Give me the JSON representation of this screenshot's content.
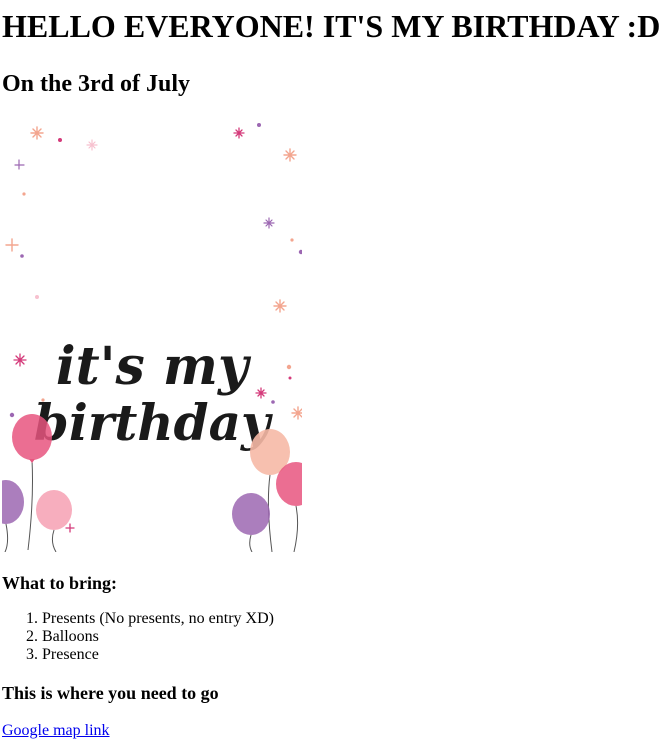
{
  "page": {
    "heading": "HELLO EVERYONE! IT'S MY BIRTHDAY :D",
    "subheading": "On the 3rd of July",
    "card": {
      "line1": "it's my",
      "line2": "birthday",
      "colors": {
        "pink": "#e8557f",
        "peach": "#f6b9a6",
        "purple": "#9c67b2",
        "ink": "#1a1a1a"
      }
    },
    "bring_heading": "What to bring:",
    "bring_items": [
      "Presents (No presents, no entry XD)",
      "Balloons",
      "Presence"
    ],
    "go_heading": "This is where you need to go",
    "map_link": "Google map link",
    "link_color": "#0000ee"
  }
}
